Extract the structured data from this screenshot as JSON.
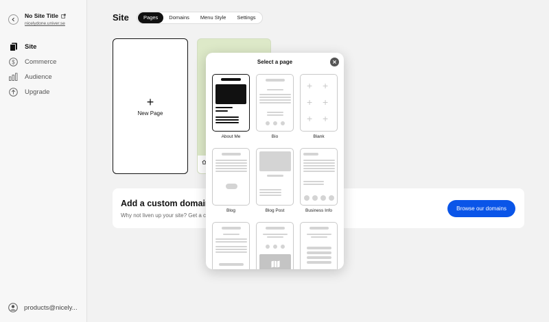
{
  "sidebar": {
    "site_title": "No Site Title",
    "site_url": "nicelydone.univer.se",
    "nav": [
      {
        "label": "Site",
        "icon": "pages-icon",
        "active": true
      },
      {
        "label": "Commerce",
        "icon": "dollar-icon",
        "active": false
      },
      {
        "label": "Audience",
        "icon": "bar-chart-icon",
        "active": false
      },
      {
        "label": "Upgrade",
        "icon": "upgrade-arrow-icon",
        "active": false
      }
    ],
    "account_email": "products@nicely..."
  },
  "header": {
    "title": "Site",
    "tabs": [
      "Pages",
      "Domains",
      "Menu Style",
      "Settings"
    ],
    "active_tab": "Pages"
  },
  "pages": {
    "new_page_label": "New Page",
    "plus_glyph": "+"
  },
  "banner": {
    "heading": "Add a custom domain",
    "subtext": "Why not liven up your site? Get a c",
    "button_label": "Browse our domains",
    "button_color": "#0a55e8"
  },
  "modal": {
    "title": "Select a page",
    "templates": [
      {
        "name": "About Me",
        "selected": true
      },
      {
        "name": "Bio",
        "selected": false
      },
      {
        "name": "Blank",
        "selected": false
      },
      {
        "name": "Blog",
        "selected": false
      },
      {
        "name": "Blog Post",
        "selected": false
      },
      {
        "name": "Business Info",
        "selected": false
      },
      {
        "name": "",
        "selected": false
      },
      {
        "name": "",
        "selected": false
      },
      {
        "name": "",
        "selected": false
      }
    ]
  }
}
